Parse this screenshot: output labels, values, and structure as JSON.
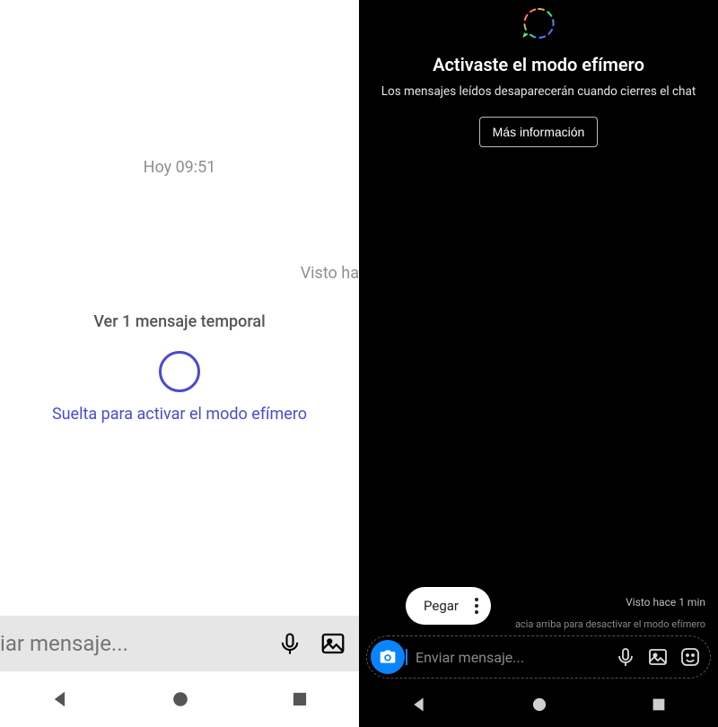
{
  "left": {
    "timestamp": "Hoy 09:51",
    "seen_text": "Visto ha",
    "ephemeral_title": "Ver 1 mensaje temporal",
    "release_hint": "Suelta para activar el modo efímero",
    "message_placeholder": "iar mensaje..."
  },
  "right": {
    "title": "Activaste el modo efímero",
    "subtitle": "Los mensajes leídos desaparecerán cuando cierres el chat",
    "more_info_label": "Más información",
    "seen_text": "Visto hace 1 min",
    "swipe_hint": "acia arriba para desactivar el modo efímero",
    "paste_label": "Pegar",
    "message_placeholder": "Enviar mensaje..."
  },
  "icons": {
    "mic": "mic-icon",
    "gallery": "gallery-icon",
    "sticker": "sticker-icon",
    "camera": "camera-icon",
    "kebab": "more-vertical-icon",
    "rainbow_bubble": "chat-bubble-rainbow-icon",
    "nav_back": "nav-back-icon",
    "nav_home": "nav-home-icon",
    "nav_recent": "nav-recent-icon"
  },
  "colors": {
    "accent_left": "#4b4bcf",
    "accent_right": "#0a84ff"
  }
}
